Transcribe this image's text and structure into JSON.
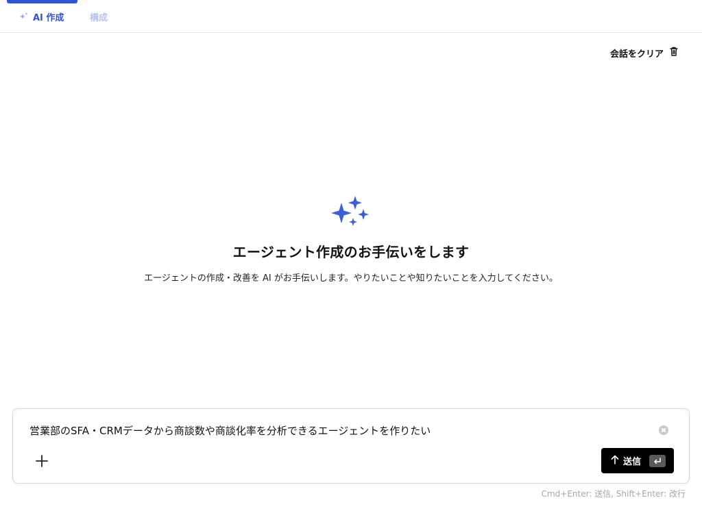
{
  "tabs": [
    {
      "label": "AI 作成",
      "icon": "sparkle-icon",
      "active": true
    },
    {
      "label": "構成",
      "active": false
    }
  ],
  "toolbar": {
    "clear_label": "会話をクリア",
    "clear_icon": "trash-icon"
  },
  "hero": {
    "icon": "sparkles-icon",
    "title": "エージェント作成のお手伝いをします",
    "description": "エージェントの作成・改善を AI がお手伝いします。やりたいことや知りたいことを入力してください。"
  },
  "composer": {
    "value": "営業部のSFA・CRMデータから商談数や商談化率を分析できるエージェントを作りたい",
    "send_label": "送信",
    "send_icon": "arrow-up-icon",
    "enter_icon": "enter-key-icon"
  },
  "hint": "Cmd+Enter: 送信, Shift+Enter: 改行",
  "colors": {
    "accent": "#2f55d4",
    "inactive_tab": "#b8c3ee",
    "send_bg": "#000000"
  }
}
